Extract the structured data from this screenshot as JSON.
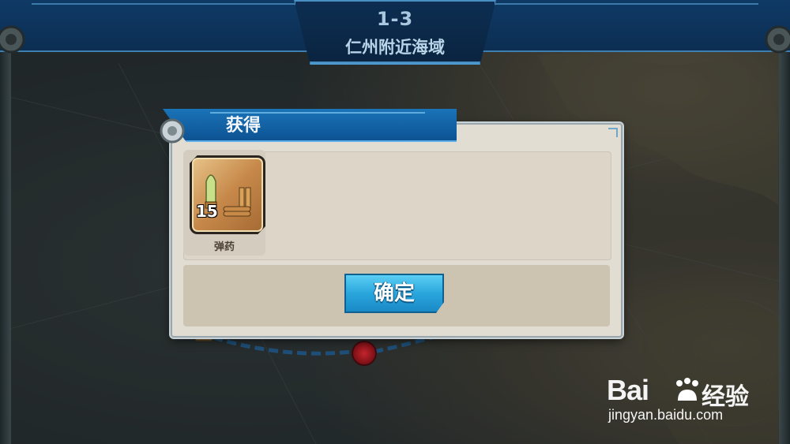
{
  "top_bar": {
    "stage_number": "1-3",
    "stage_name": "仁州附近海域"
  },
  "dialog": {
    "title": "获得",
    "items": [
      {
        "name": "弹药",
        "quantity": "15",
        "icon": "ammo-icon"
      }
    ],
    "confirm_label": "确定"
  },
  "watermark": {
    "brand_prefix": "Bai",
    "brand_suffix": "经验",
    "url": "jingyan.baidu.com"
  },
  "colors": {
    "header_blue": "#0d5393",
    "button_blue": "#2aa6dd",
    "dialog_bg": "#e2ddd2",
    "map_node_red": "#c4242c"
  }
}
